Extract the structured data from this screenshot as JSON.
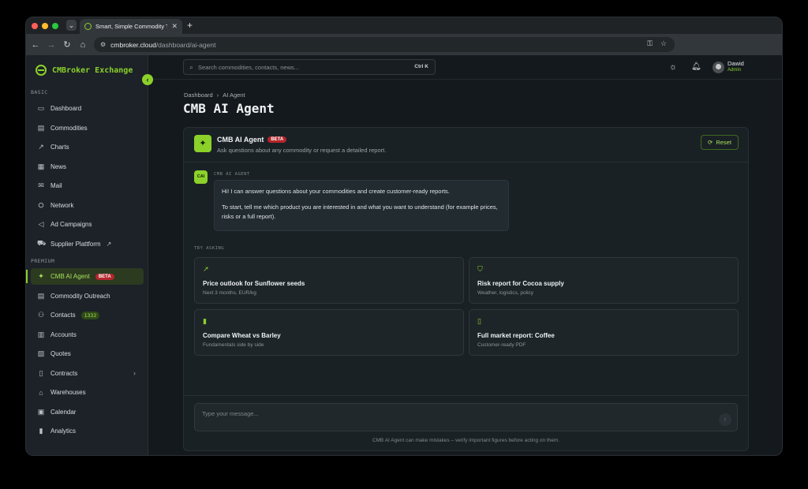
{
  "browser": {
    "tab_title": "Smart, Simple Commodity Tr...",
    "url_host": "cmbroker.cloud",
    "url_path": "/dashboard/ai-agent"
  },
  "sidebar": {
    "brand": "CMBroker Exchange",
    "sections": {
      "basic": "BASIC",
      "premium": "PREMIUM"
    },
    "basic_items": [
      {
        "label": "Dashboard",
        "icon": "monitor-icon"
      },
      {
        "label": "Commodities",
        "icon": "box-icon"
      },
      {
        "label": "Charts",
        "icon": "trend-icon"
      },
      {
        "label": "News",
        "icon": "newspaper-icon"
      },
      {
        "label": "Mail",
        "icon": "mail-icon"
      },
      {
        "label": "Network",
        "icon": "network-icon"
      },
      {
        "label": "Ad Campaigns",
        "icon": "megaphone-icon"
      },
      {
        "label": "Supplier Plattform",
        "icon": "truck-icon"
      }
    ],
    "premium_items": [
      {
        "label": "CMB AI Agent",
        "badge": "BETA",
        "icon": "sparkles-icon"
      },
      {
        "label": "Commodity Outreach",
        "icon": "box-icon"
      },
      {
        "label": "Contacts",
        "badge": "1332",
        "icon": "users-icon"
      },
      {
        "label": "Accounts",
        "icon": "building-icon"
      },
      {
        "label": "Quotes",
        "icon": "receipt-icon"
      },
      {
        "label": "Contracts",
        "icon": "file-icon"
      },
      {
        "label": "Warehouses",
        "icon": "warehouse-icon"
      },
      {
        "label": "Calendar",
        "icon": "calendar-icon"
      },
      {
        "label": "Analytics",
        "icon": "bar-chart-icon"
      }
    ]
  },
  "topbar": {
    "search_placeholder": "Search commodities, contacts, news...",
    "search_shortcut": "Ctrl K",
    "user_name": "Dawid",
    "user_role": "Admin"
  },
  "page": {
    "breadcrumb": [
      "Dashboard",
      "AI Agent"
    ],
    "title": "CMB AI Agent"
  },
  "agent": {
    "name": "CMB AI Agent",
    "badge": "BETA",
    "subtitle": "Ask questions about any commodity or request a detailed report.",
    "reset_label": "Reset",
    "avatar_text": "CAI",
    "message_from": "CMB AI AGENT",
    "message_lines": [
      "Hi! I can answer questions about your commodities and create customer-ready reports.",
      "To start, tell me which product you are interested in and what you want to understand (for example prices, risks or a full report)."
    ],
    "try_label": "TRY ASKING",
    "suggestions": [
      {
        "title": "Price outlook for Sunflower seeds",
        "sub": "Next 3 months, EUR/kg",
        "icon": "trend-up-icon"
      },
      {
        "title": "Risk report for Cocoa supply",
        "sub": "Weather, logistics, policy",
        "icon": "shield-check-icon"
      },
      {
        "title": "Compare Wheat vs Barley",
        "sub": "Fundamentals side by side",
        "icon": "bar-chart-icon"
      },
      {
        "title": "Full market report: Coffee",
        "sub": "Customer-ready PDF",
        "icon": "document-icon"
      }
    ],
    "input_placeholder": "Type your message...",
    "disclaimer": "CMB AI Agent can make mistakes – verify important figures before acting on them."
  }
}
